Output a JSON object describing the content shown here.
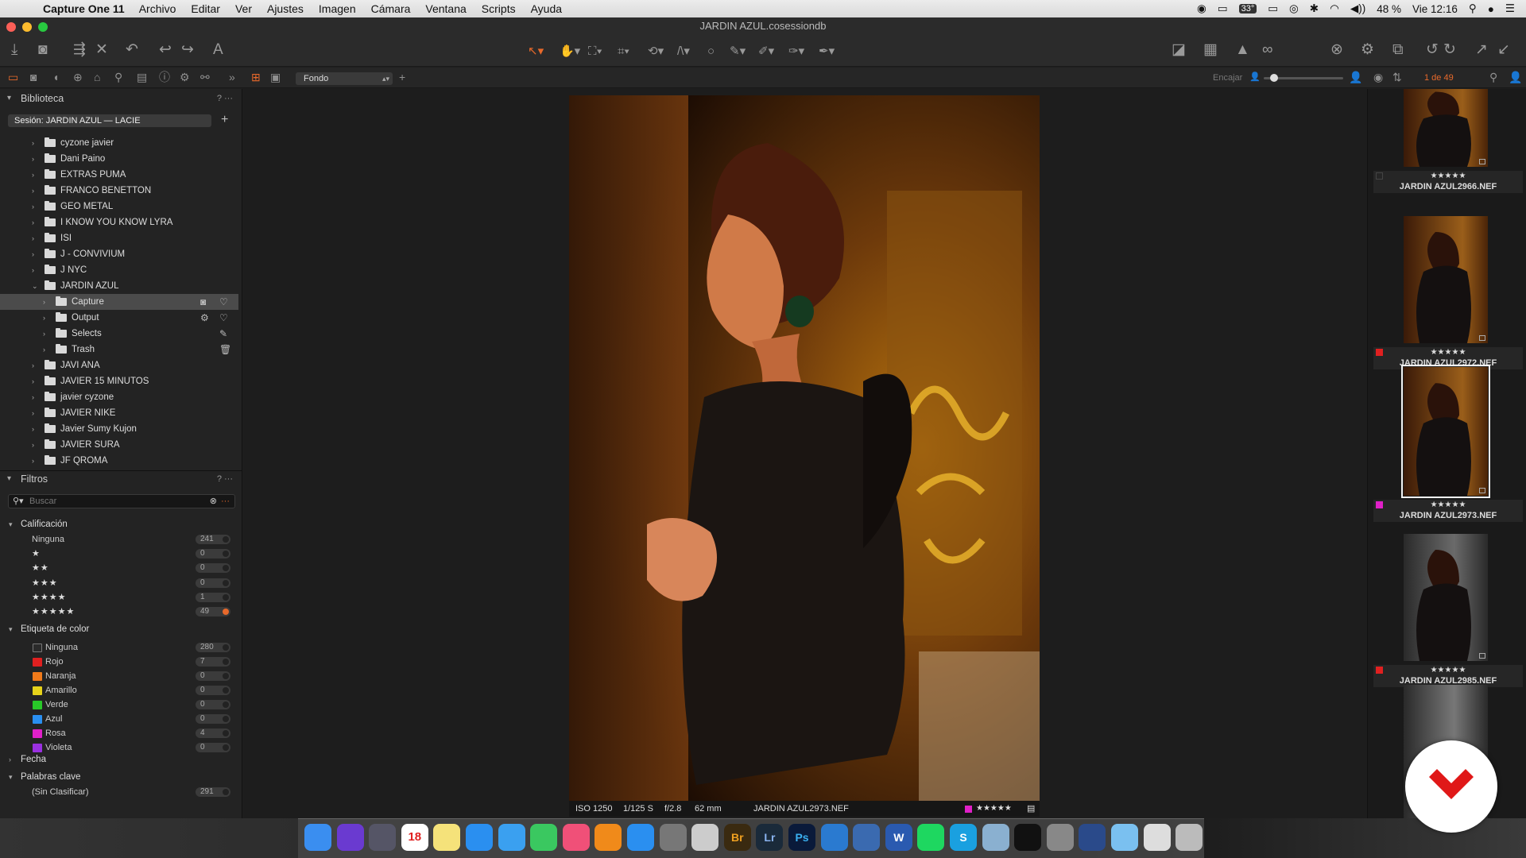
{
  "menubar": {
    "app_name": "Capture One 11",
    "items": [
      "Archivo",
      "Editar",
      "Ver",
      "Ajustes",
      "Imagen",
      "Cámara",
      "Ventana",
      "Scripts",
      "Ayuda"
    ],
    "temperature": "33°",
    "battery": "48 %",
    "clock": "Vie 12:16"
  },
  "window": {
    "title": "JARDIN AZUL.cosessiondb"
  },
  "viewer_toolbar": {
    "style_select": "Fondo",
    "fit_label": "Encajar",
    "counter": "1 de 49",
    "accent_color": "#e8692b"
  },
  "library": {
    "header": "Biblioteca",
    "help": "?",
    "session": "Sesión: JARDIN AZUL — LACIE",
    "folders": [
      {
        "label": "cyzone javier"
      },
      {
        "label": "Dani Paino"
      },
      {
        "label": "EXTRAS PUMA"
      },
      {
        "label": "FRANCO BENETTON"
      },
      {
        "label": "GEO METAL"
      },
      {
        "label": "I KNOW YOU KNOW LYRA"
      },
      {
        "label": "ISI"
      },
      {
        "label": "J - CONVIVIUM"
      },
      {
        "label": "J NYC"
      },
      {
        "label": "JARDIN AZUL"
      },
      {
        "label": "Capture"
      },
      {
        "label": "Output"
      },
      {
        "label": "Selects"
      },
      {
        "label": "Trash"
      },
      {
        "label": "JAVI ANA"
      },
      {
        "label": "JAVIER 15 MINUTOS"
      },
      {
        "label": "javier cyzone"
      },
      {
        "label": "JAVIER NIKE"
      },
      {
        "label": "Javier Sumy Kujon"
      },
      {
        "label": "JAVIER SURA"
      },
      {
        "label": "JF QROMA"
      }
    ]
  },
  "filters": {
    "header": "Filtros",
    "help": "?",
    "search_placeholder": "Buscar",
    "rating_header": "Calificación",
    "ratings": [
      {
        "label": "Ninguna",
        "count": "241"
      },
      {
        "label": "★",
        "count": "0"
      },
      {
        "label": "★★",
        "count": "0"
      },
      {
        "label": "★★★",
        "count": "0"
      },
      {
        "label": "★★★★",
        "count": "1"
      },
      {
        "label": "★★★★★",
        "count": "49"
      }
    ],
    "color_header": "Etiqueta de color",
    "colors": [
      {
        "label": "Ninguna",
        "count": "280",
        "color": "#2a2a2a"
      },
      {
        "label": "Rojo",
        "count": "7",
        "color": "#e02020"
      },
      {
        "label": "Naranja",
        "count": "0",
        "color": "#f07a1a"
      },
      {
        "label": "Amarillo",
        "count": "0",
        "color": "#e6d21a"
      },
      {
        "label": "Verde",
        "count": "0",
        "color": "#28c828"
      },
      {
        "label": "Azul",
        "count": "0",
        "color": "#2a8ff0"
      },
      {
        "label": "Rosa",
        "count": "4",
        "color": "#e020c8"
      },
      {
        "label": "Violeta",
        "count": "0",
        "color": "#9a30e0"
      }
    ],
    "date_header": "Fecha",
    "keywords_header": "Palabras clave",
    "keywords": [
      {
        "label": "(Sin Clasificar)",
        "count": "291"
      }
    ]
  },
  "viewer": {
    "iso": "ISO 1250",
    "shutter": "1/125 S",
    "aperture": "f/2.8",
    "focal": "62 mm",
    "filename": "JARDIN AZUL2973.NEF",
    "rating": "★★★★★",
    "tag_color": "#e020c8"
  },
  "browser": {
    "thumbs": [
      {
        "name": "JARDIN AZUL2966.NEF",
        "stars": "★★★★★",
        "tag_color": ""
      },
      {
        "name": "JARDIN AZUL2972.NEF",
        "stars": "★★★★★",
        "tag_color": "#e02020"
      },
      {
        "name": "JARDIN AZUL2973.NEF",
        "stars": "★★★★★",
        "tag_color": "#e020c8"
      },
      {
        "name": "JARDIN AZUL2985.NEF",
        "stars": "★★★★★",
        "tag_color": "#e02020"
      }
    ]
  },
  "dock": {
    "calendar_day": "18",
    "apps": [
      "finder-icon",
      "siri-icon",
      "launchpad-icon",
      "calendar-icon",
      "notes-icon",
      "safari-icon",
      "messages-icon",
      "facetime-icon",
      "itunes-icon",
      "ibooks-icon",
      "appstore-icon",
      "settings-icon",
      "notepad-icon",
      "bridge-icon",
      "lightroom-icon",
      "photoshop-icon",
      "onepassword-icon",
      "keynote-icon",
      "word-icon",
      "spotify-icon",
      "skype-icon",
      "preview-icon",
      "terminal-icon",
      "automator-icon",
      "quicktime-icon",
      "folder-icon",
      "document-icon",
      "trash-icon"
    ],
    "labels": {
      "bridge": "Br",
      "lightroom": "Lr",
      "photoshop": "Ps",
      "word": "W",
      "skype": "S"
    }
  }
}
